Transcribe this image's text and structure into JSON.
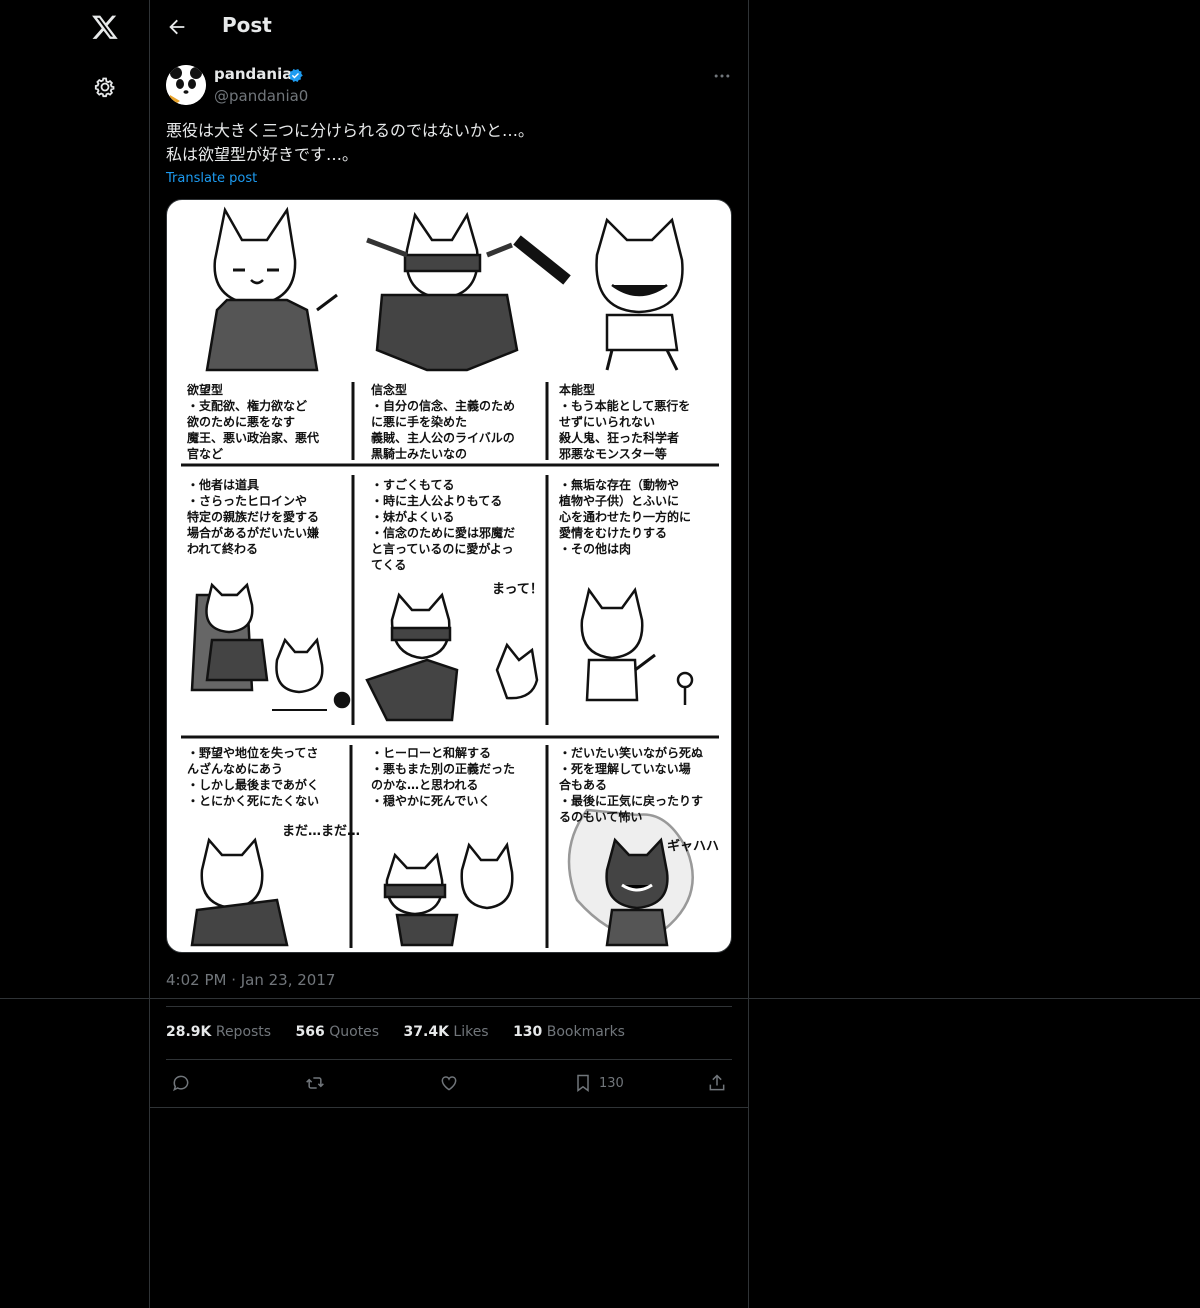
{
  "header": {
    "title": "Post"
  },
  "author": {
    "name": "pandania",
    "handle": "@pandania0"
  },
  "post": {
    "lines": [
      "悪役は大きく三つに分けられるのではないかと…。",
      "私は欲望型が好きです…。"
    ],
    "translate_label": "Translate post",
    "time": "4:02 PM · Jan 23, 2017"
  },
  "image": {
    "col1": {
      "title": "欲望型",
      "lines1": [
        "・支配欲、権力欲など",
        "欲のために悪をなす",
        "魔王、悪い政治家、悪代",
        "官など"
      ],
      "lines2": [
        "・他者は道具",
        "・さらったヒロインや",
        "特定の親族だけを愛する",
        "場合があるがだいたい嫌",
        "われて終わる"
      ],
      "lines3": [
        "・野望や地位を失ってさ",
        "んざんなめにあう",
        "・しかし最後まであがく",
        "・とにかく死にたくない"
      ],
      "sfx": "まだ…まだ…"
    },
    "col2": {
      "title": "信念型",
      "lines1": [
        "・自分の信念、主義のため",
        "に悪に手を染めた",
        "義賊、主人公のライバルの",
        "黒騎士みたいなの"
      ],
      "lines2": [
        "・すごくもてる",
        "・時に主人公よりもてる",
        "・妹がよくいる",
        "・信念のために愛は邪魔だ",
        "と言っているのに愛がよっ",
        "てくる"
      ],
      "lines3": [
        "・ヒーローと和解する",
        "・悪もまた別の正義だった",
        "のかな…と思われる",
        "・穏やかに死んでいく"
      ],
      "sfx": "まって！"
    },
    "col3": {
      "title": "本能型",
      "lines1": [
        "・もう本能として悪行を",
        "せずにいられない",
        "殺人鬼、狂った科学者",
        "邪悪なモンスター等"
      ],
      "lines2": [
        "・無垢な存在（動物や",
        "植物や子供）とふいに",
        "心を通わせたり一方的に",
        "愛情をむけたりする",
        "・その他は肉"
      ],
      "lines3": [
        "・だいたい笑いながら死ぬ",
        "・死を理解していない場",
        "合もある",
        "・最後に正気に戻ったりす",
        "るのもいて怖い"
      ],
      "sfx": "ギャハハ"
    }
  },
  "stats": [
    {
      "value": "28.9K",
      "label": "Reposts"
    },
    {
      "value": "566",
      "label": "Quotes"
    },
    {
      "value": "37.4K",
      "label": "Likes"
    },
    {
      "value": "130",
      "label": "Bookmarks"
    }
  ],
  "actions": {
    "bookmark_count": "130"
  },
  "colors": {
    "accent": "#1d9bf0",
    "background": "#000000",
    "border": "#2f3336",
    "muted": "#71767b"
  }
}
